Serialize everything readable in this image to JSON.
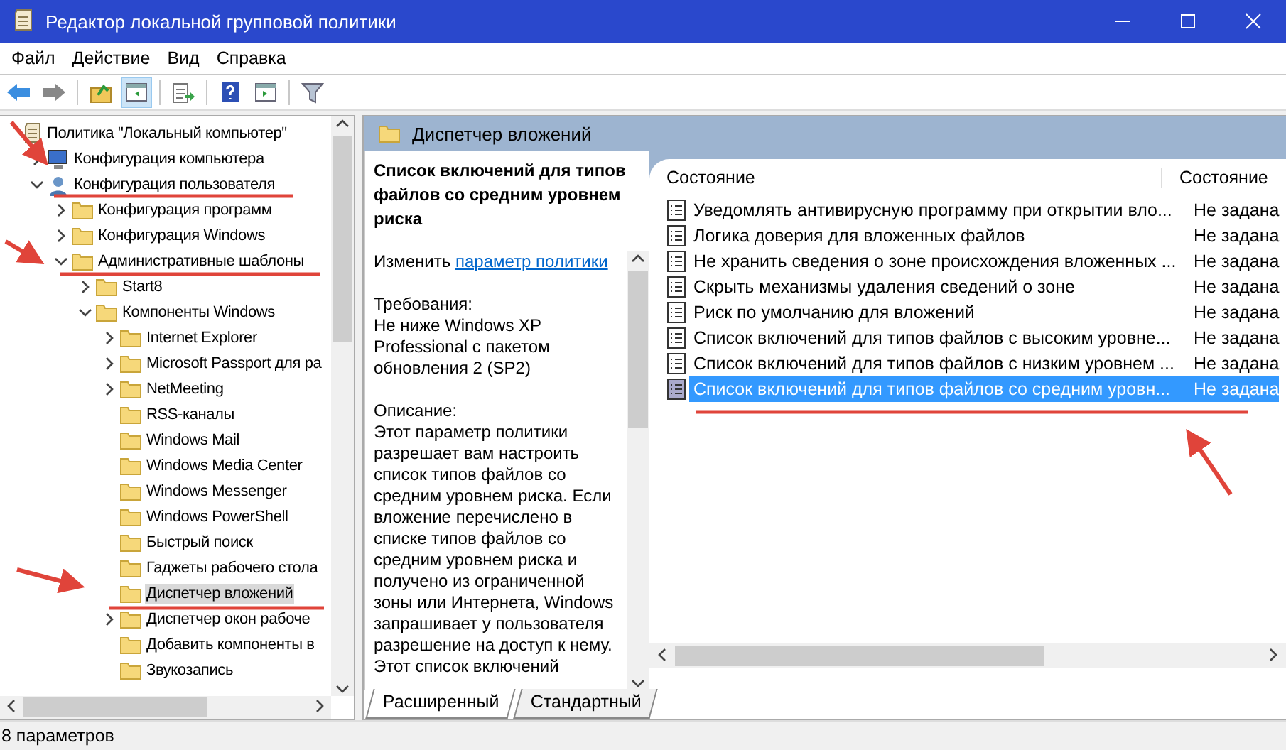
{
  "window": {
    "title": "Редактор локальной групповой политики"
  },
  "menu": [
    "Файл",
    "Действие",
    "Вид",
    "Справка"
  ],
  "toolbar": [
    {
      "kind": "back",
      "selected": false
    },
    {
      "kind": "forward",
      "selected": false
    },
    {
      "kind": "sep"
    },
    {
      "kind": "up",
      "selected": false
    },
    {
      "kind": "pane",
      "selected": true
    },
    {
      "kind": "sep"
    },
    {
      "kind": "export",
      "selected": false
    },
    {
      "kind": "sep"
    },
    {
      "kind": "help",
      "selected": false
    },
    {
      "kind": "panel",
      "selected": false
    },
    {
      "kind": "sep"
    },
    {
      "kind": "filter",
      "selected": false
    }
  ],
  "tree": [
    {
      "label": "Политика \"Локальный компьютер\"",
      "kind": "root",
      "selected": false,
      "children": [
        {
          "label": "Конфигурация компьютера",
          "kind": "computer",
          "selected": false,
          "expanded": false
        },
        {
          "label": "Конфигурация пользователя",
          "kind": "user",
          "selected": false,
          "expanded": true,
          "children": [
            {
              "label": "Конфигурация программ",
              "kind": "folder",
              "selected": false,
              "expanded": false
            },
            {
              "label": "Конфигурация Windows",
              "kind": "folder",
              "selected": false,
              "expanded": false
            },
            {
              "label": "Административные шаблоны",
              "kind": "folder",
              "selected": false,
              "expanded": true,
              "children": [
                {
                  "label": "Start8",
                  "kind": "folder",
                  "selected": false,
                  "expanded": false
                },
                {
                  "label": "Компоненты Windows",
                  "kind": "folder",
                  "selected": false,
                  "expanded": true,
                  "children": [
                    {
                      "label": "Internet Explorer",
                      "kind": "folder",
                      "selected": false,
                      "expanded": false
                    },
                    {
                      "label": "Microsoft Passport для ра",
                      "kind": "folder",
                      "selected": false,
                      "expanded": false
                    },
                    {
                      "label": "NetMeeting",
                      "kind": "folder",
                      "selected": false,
                      "expanded": false
                    },
                    {
                      "label": "RSS-каналы",
                      "kind": "folder",
                      "selected": false
                    },
                    {
                      "label": "Windows Mail",
                      "kind": "folder",
                      "selected": false
                    },
                    {
                      "label": "Windows Media Center",
                      "kind": "folder",
                      "selected": false
                    },
                    {
                      "label": "Windows Messenger",
                      "kind": "folder",
                      "selected": false
                    },
                    {
                      "label": "Windows PowerShell",
                      "kind": "folder",
                      "selected": false
                    },
                    {
                      "label": "Быстрый поиск",
                      "kind": "folder",
                      "selected": false
                    },
                    {
                      "label": "Гаджеты рабочего стола",
                      "kind": "folder",
                      "selected": false
                    },
                    {
                      "label": "Диспетчер вложений",
                      "kind": "folder",
                      "selected": true
                    },
                    {
                      "label": "Диспетчер окон рабоче",
                      "kind": "folder",
                      "selected": false,
                      "expanded": false
                    },
                    {
                      "label": "Добавить компоненты в",
                      "kind": "folder",
                      "selected": false
                    },
                    {
                      "label": "Звукозапись",
                      "kind": "folder",
                      "selected": false
                    }
                  ]
                }
              ]
            }
          ]
        }
      ]
    }
  ],
  "header": {
    "title": "Диспетчер вложений"
  },
  "description": {
    "title": "Список включений для типов файлов со средним уровнем риска",
    "edit_prefix": "Изменить",
    "edit_link": "параметр политики",
    "requirements_label": "Требования:",
    "requirements": "Не ниже Windows XP Professional с пакетом обновления 2 (SP2)",
    "description_label": "Описание:",
    "description": "Этот параметр политики разрешает вам настроить список типов файлов со средним уровнем риска. Если вложение перечислено в списке типов файлов со средним уровнем риска и получено из ограниченной зоны или Интернета, Windows запрашивает у пользователя разрешение на доступ к нему. Этот список включений"
  },
  "table": {
    "columns": [
      "Состояние",
      "Состояние"
    ],
    "rows": [
      {
        "name": "Уведомлять антивирусную программу при открытии вло...",
        "state": "Не задана",
        "selected": false
      },
      {
        "name": "Логика доверия для вложенных файлов",
        "state": "Не задана",
        "selected": false
      },
      {
        "name": "Не хранить сведения о зоне происхождения вложенных ...",
        "state": "Не задана",
        "selected": false
      },
      {
        "name": "Скрыть механизмы удаления сведений о зоне",
        "state": "Не задана",
        "selected": false
      },
      {
        "name": "Риск по умолчанию для вложений",
        "state": "Не задана",
        "selected": false
      },
      {
        "name": "Список включений для типов файлов с высоким уровне...",
        "state": "Не задана",
        "selected": false
      },
      {
        "name": "Список включений для типов файлов с низким уровнем ...",
        "state": "Не задана",
        "selected": false
      },
      {
        "name": "Список включений для типов файлов со средним уровн...",
        "state": "Не задана",
        "selected": true
      }
    ]
  },
  "tabs": [
    {
      "label": "Расширенный",
      "selected": true
    },
    {
      "label": "Стандартный",
      "selected": false
    }
  ],
  "status_bar": "8 параметров"
}
